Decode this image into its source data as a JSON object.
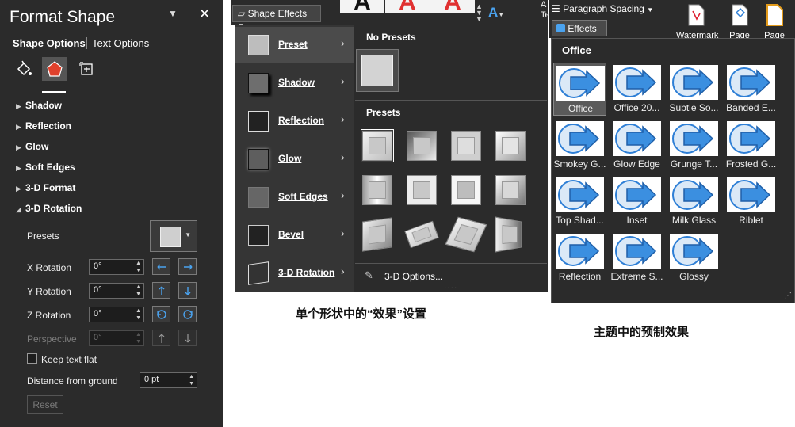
{
  "format_shape": {
    "title": "Format Shape",
    "tabs": [
      "Shape Options",
      "Text Options"
    ],
    "sections": [
      {
        "label": "Shadow",
        "expanded": false
      },
      {
        "label": "Reflection",
        "expanded": false
      },
      {
        "label": "Glow",
        "expanded": false
      },
      {
        "label": "Soft Edges",
        "expanded": false
      },
      {
        "label": "3-D Format",
        "expanded": false
      },
      {
        "label": "3-D Rotation",
        "expanded": true
      }
    ],
    "presets_label": "Presets",
    "x_rotation": {
      "label": "X Rotation",
      "value": "0°"
    },
    "y_rotation": {
      "label": "Y Rotation",
      "value": "0°"
    },
    "z_rotation": {
      "label": "Z Rotation",
      "value": "0°"
    },
    "perspective": {
      "label": "Perspective",
      "value": "0°"
    },
    "keep_text_flat": "Keep text flat",
    "distance": {
      "label": "Distance from ground",
      "value": "0 pt"
    },
    "reset": "Reset"
  },
  "shape_effects": {
    "button_label": "Shape Effects",
    "menu_items": [
      "Preset",
      "Shadow",
      "Reflection",
      "Glow",
      "Soft Edges",
      "Bevel",
      "3-D Rotation"
    ],
    "no_presets_heading": "No Presets",
    "presets_heading": "Presets",
    "options_label": "3-D Options...",
    "caption": "单个形状中的“效果”设置"
  },
  "theme": {
    "paragraph_spacing": "Paragraph Spacing",
    "effects_button": "Effects",
    "watermark": "Watermark",
    "page1": "Page",
    "page2": "Page",
    "gallery_heading": "Office",
    "effects": [
      "Office",
      "Office 20...",
      "Subtle So...",
      "Banded E...",
      "Smokey G...",
      "Glow Edge",
      "Grunge T...",
      "Frosted G...",
      "Top Shad...",
      "Inset",
      "Milk Glass",
      "Riblet",
      "Reflection",
      "Extreme S...",
      "Glossy"
    ],
    "caption": "主题中的预制效果"
  },
  "colors": {
    "accent_blue": "#2e7fd6",
    "pane_bg": "#2b2b2b",
    "menu_bg": "#353535"
  }
}
